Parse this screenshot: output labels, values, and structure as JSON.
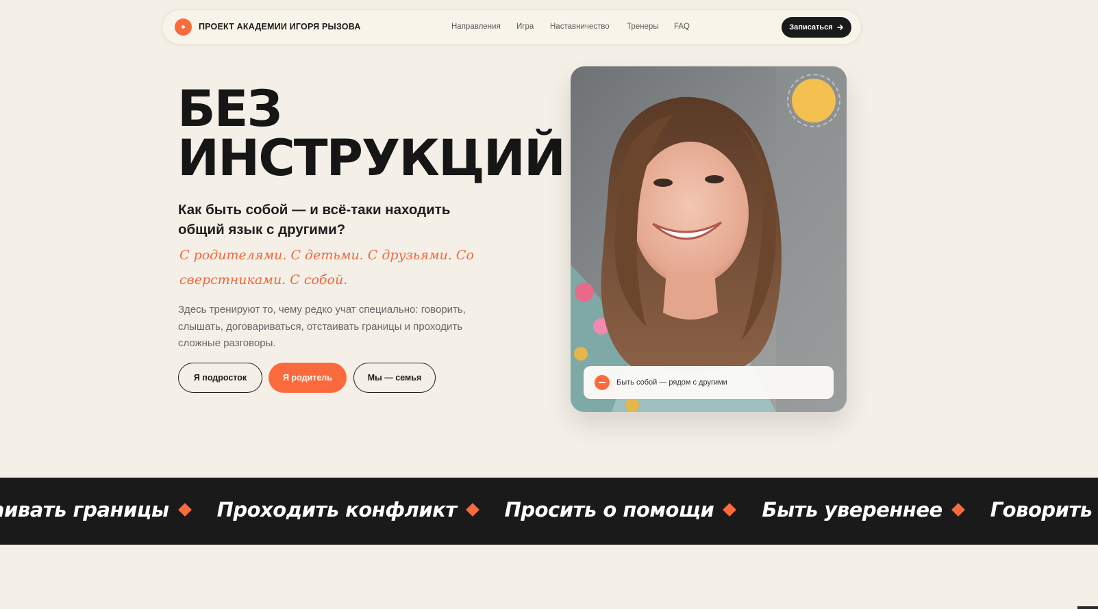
{
  "header": {
    "brand": "ПРОЕКТ АКАДЕМИИ ИГОРЯ РЫЗОВА",
    "nav": [
      "Направления",
      "Игра",
      "Наставничество",
      "Тренеры",
      "FAQ"
    ],
    "signup_label": "Записаться",
    "signup_icon": "arrow-right-icon"
  },
  "hero": {
    "title_line1": "БЕЗ",
    "title_line2": "ИНСТРУКЦИЙ",
    "question": "Как быть собой — и всё-таки находить общий язык с другими?",
    "script": "С родителями. С детьми. С друзьями. Со сверстниками. С собой.",
    "description": "Здесь тренируют то, чему редко учат специально: говорить, слышать, договариваться, отстаивать границы и проходить сложные разговоры.",
    "buttons": {
      "teen": "Я подросток",
      "parent": "Я родитель",
      "family": "Мы — семья"
    },
    "photo_caption": "Быть собой — рядом с другими"
  },
  "marquee": {
    "items": [
      "аивать границы",
      "Проходить конфликт",
      "Просить о помощи",
      "Быть увереннее",
      "Говорить о себе"
    ]
  },
  "colors": {
    "accent": "#fb6a3c",
    "background": "#f4efe7",
    "dark": "#1a1a1a",
    "sun": "#f4c04f"
  }
}
